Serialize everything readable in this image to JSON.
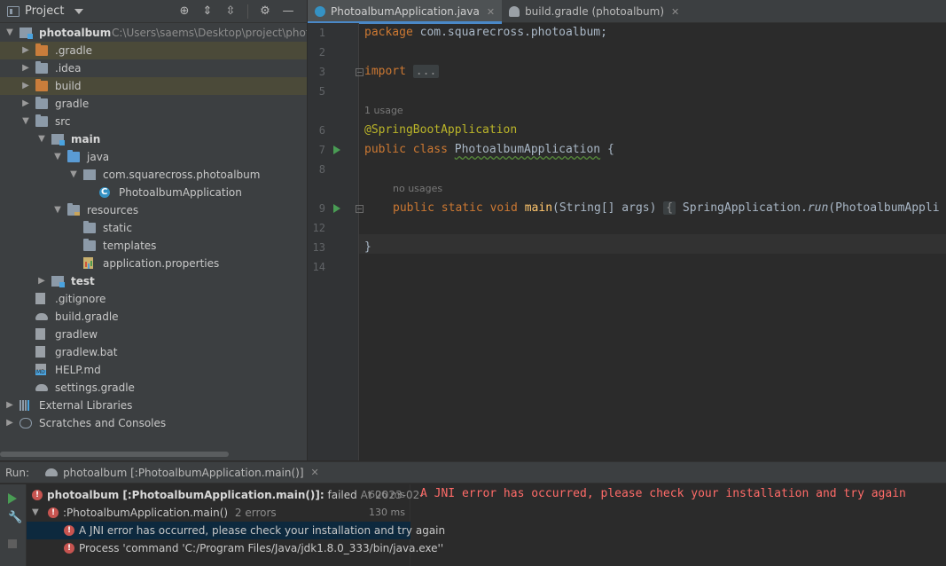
{
  "project_panel": {
    "title": "Project",
    "tree": [
      {
        "label": "photoalbum",
        "path": "C:\\Users\\saems\\Desktop\\project\\photo",
        "bold": true,
        "indent": 0,
        "arrow": "down",
        "icon": "module-folder-icon"
      },
      {
        "label": ".gradle",
        "indent": 1,
        "arrow": "right",
        "icon": "folder-orange-icon",
        "selected": true
      },
      {
        "label": ".idea",
        "indent": 1,
        "arrow": "right",
        "icon": "folder-icon"
      },
      {
        "label": "build",
        "indent": 1,
        "arrow": "right",
        "icon": "folder-orange-icon",
        "selected": true
      },
      {
        "label": "gradle",
        "indent": 1,
        "arrow": "right",
        "icon": "folder-icon"
      },
      {
        "label": "src",
        "indent": 1,
        "arrow": "down",
        "icon": "folder-icon"
      },
      {
        "label": "main",
        "bold": true,
        "indent": 2,
        "arrow": "down",
        "icon": "module-folder-icon"
      },
      {
        "label": "java",
        "indent": 3,
        "arrow": "down",
        "icon": "folder-blue-icon"
      },
      {
        "label": "com.squarecross.photoalbum",
        "indent": 4,
        "arrow": "down",
        "icon": "package-icon"
      },
      {
        "label": "PhotoalbumApplication",
        "indent": 5,
        "arrow": "",
        "icon": "spring-class-icon"
      },
      {
        "label": "resources",
        "indent": 3,
        "arrow": "down",
        "icon": "resources-folder-icon"
      },
      {
        "label": "static",
        "indent": 4,
        "arrow": "",
        "icon": "folder-icon"
      },
      {
        "label": "templates",
        "indent": 4,
        "arrow": "",
        "icon": "folder-icon"
      },
      {
        "label": "application.properties",
        "indent": 4,
        "arrow": "",
        "icon": "properties-file-icon"
      },
      {
        "label": "test",
        "bold": true,
        "indent": 2,
        "arrow": "right",
        "icon": "module-folder-icon"
      },
      {
        "label": ".gitignore",
        "indent": 1,
        "arrow": "",
        "icon": "file-icon"
      },
      {
        "label": "build.gradle",
        "indent": 1,
        "arrow": "",
        "icon": "gradle-icon"
      },
      {
        "label": "gradlew",
        "indent": 1,
        "arrow": "",
        "icon": "file-icon"
      },
      {
        "label": "gradlew.bat",
        "indent": 1,
        "arrow": "",
        "icon": "file-icon"
      },
      {
        "label": "HELP.md",
        "indent": 1,
        "arrow": "",
        "icon": "markdown-file-icon"
      },
      {
        "label": "settings.gradle",
        "indent": 1,
        "arrow": "",
        "icon": "gradle-icon"
      },
      {
        "label": "External Libraries",
        "indent": 0,
        "arrow": "right",
        "icon": "libraries-icon"
      },
      {
        "label": "Scratches and Consoles",
        "indent": 0,
        "arrow": "right",
        "icon": "scratches-icon"
      }
    ]
  },
  "editor": {
    "tabs": [
      {
        "label": "PhotoalbumApplication.java",
        "active": true,
        "icon": "spring-class-icon"
      },
      {
        "label": "build.gradle (photoalbum)",
        "active": false,
        "icon": "gradle-icon"
      }
    ],
    "code": {
      "l1_kw": "package",
      "l1_rest": " com.squarecross.photoalbum;",
      "l3_kw": "import",
      "l3_fold": "...",
      "hint1": "1 usage",
      "l6_ann": "@SpringBootApplication",
      "l7_kw": "public class",
      "l7_cls": "PhotoalbumApplication",
      "l7_rest": " {",
      "hint2": "no usages",
      "l9_kw": "public static void",
      "l9_fn": "main",
      "l9_args": "(String[] args) ",
      "l9_fold": "{",
      "l9_call": " SpringApplication.",
      "l9_run": "run",
      "l9_tail": "(PhotoalbumAppli",
      "l13": "}"
    },
    "line_numbers": [
      "1",
      "2",
      "3",
      "5",
      "6",
      "7",
      "8",
      "9",
      "12",
      "13",
      "14"
    ]
  },
  "run_panel": {
    "label": "Run:",
    "tab": "photoalbum [:PhotoalbumApplication.main()]",
    "tree": [
      {
        "label": "photoalbum [:PhotoalbumApplication.main()]:",
        "status": "failed",
        "meta": "At 2023-02-",
        "time": "606 ms",
        "bold": true
      },
      {
        "label": ":PhotoalbumApplication.main()",
        "meta": "2 errors",
        "time": "130 ms"
      },
      {
        "label": "A JNI error has occurred, please check your installation and try again",
        "selected": true
      },
      {
        "label": "Process 'command 'C:/Program Files/Java/jdk1.8.0_333/bin/java.exe''"
      }
    ],
    "console": "A JNI error has occurred, please check your installation and try again"
  }
}
